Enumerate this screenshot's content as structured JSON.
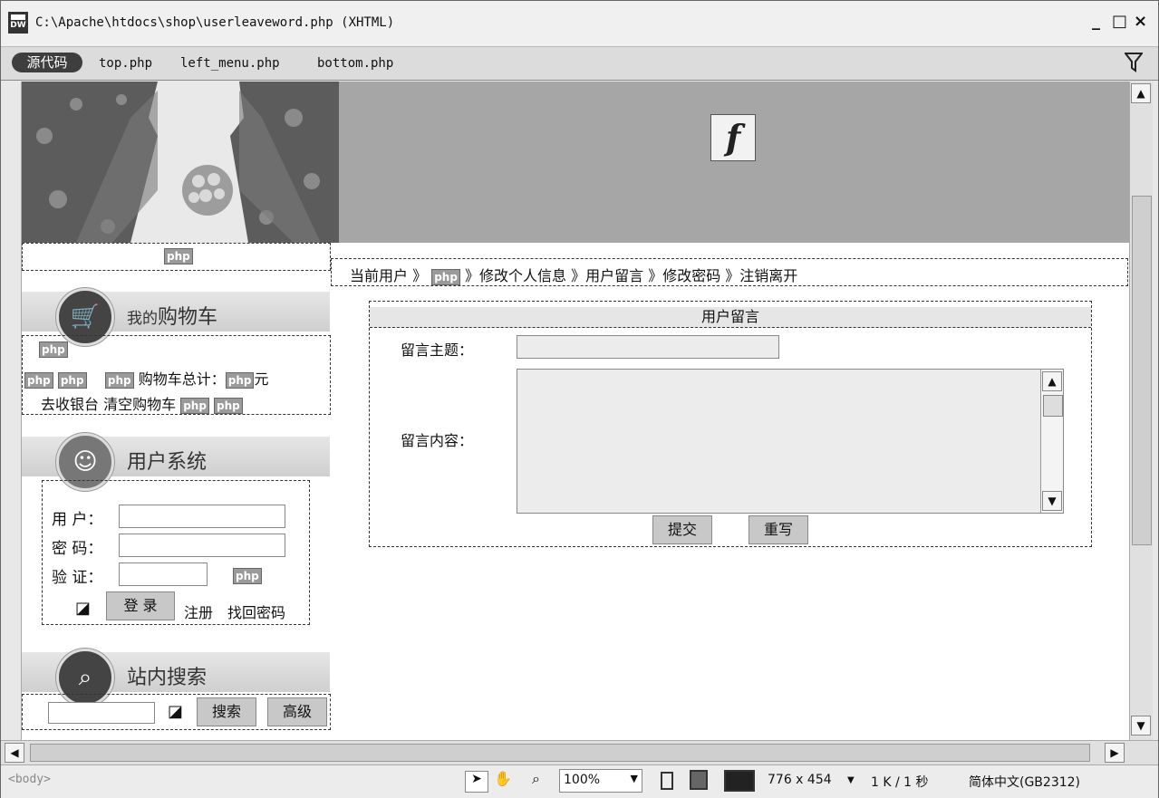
{
  "window": {
    "title": "C:\\Apache\\htdocs\\shop\\userleaveword.php (XHTML)",
    "app_icon": "DW",
    "minimize": "_",
    "maximize": "□",
    "close": "×"
  },
  "doc_toolbar": {
    "source_label": "源代码",
    "files": [
      "top.php",
      "left_menu.php",
      "bottom.php"
    ],
    "filter_icon": "filter-icon"
  },
  "page": {
    "php_tag": "php",
    "flash_glyph": "f",
    "left": {
      "cart_title_small": "我的",
      "cart_title_big": "购物车",
      "cart_total_label": "购物车总计：",
      "cart_total_unit": "元",
      "checkout_link": "去收银台",
      "clear_link": "清空购物车",
      "user_title": "用户系统",
      "user_label": "用 户：",
      "password_label": "密 码：",
      "verify_label": "验 证：",
      "login_button": "登 录",
      "register_link": "注册",
      "recover_link": "找回密码",
      "search_title": "站内搜索",
      "search_button": "搜索",
      "advanced_button": "高级"
    },
    "right": {
      "breadcrumb_prefix": "当前用户 》",
      "breadcrumb_links": "》修改个人信息 》用户留言 》修改密码 》注销离开",
      "form_title": "用户留言",
      "subject_label": "留言主题：",
      "content_label": "留言内容：",
      "submit_button": "提交",
      "reset_button": "重写"
    }
  },
  "statusbar": {
    "tag": "<body>",
    "zoom": "100%",
    "size": "776 x 454",
    "download": "1 K / 1 秒",
    "encoding": "简体中文(GB2312)"
  },
  "colors": {
    "banner_flash_bg": "#a6a6a6",
    "source_button_bg": "#3e3e3e"
  }
}
